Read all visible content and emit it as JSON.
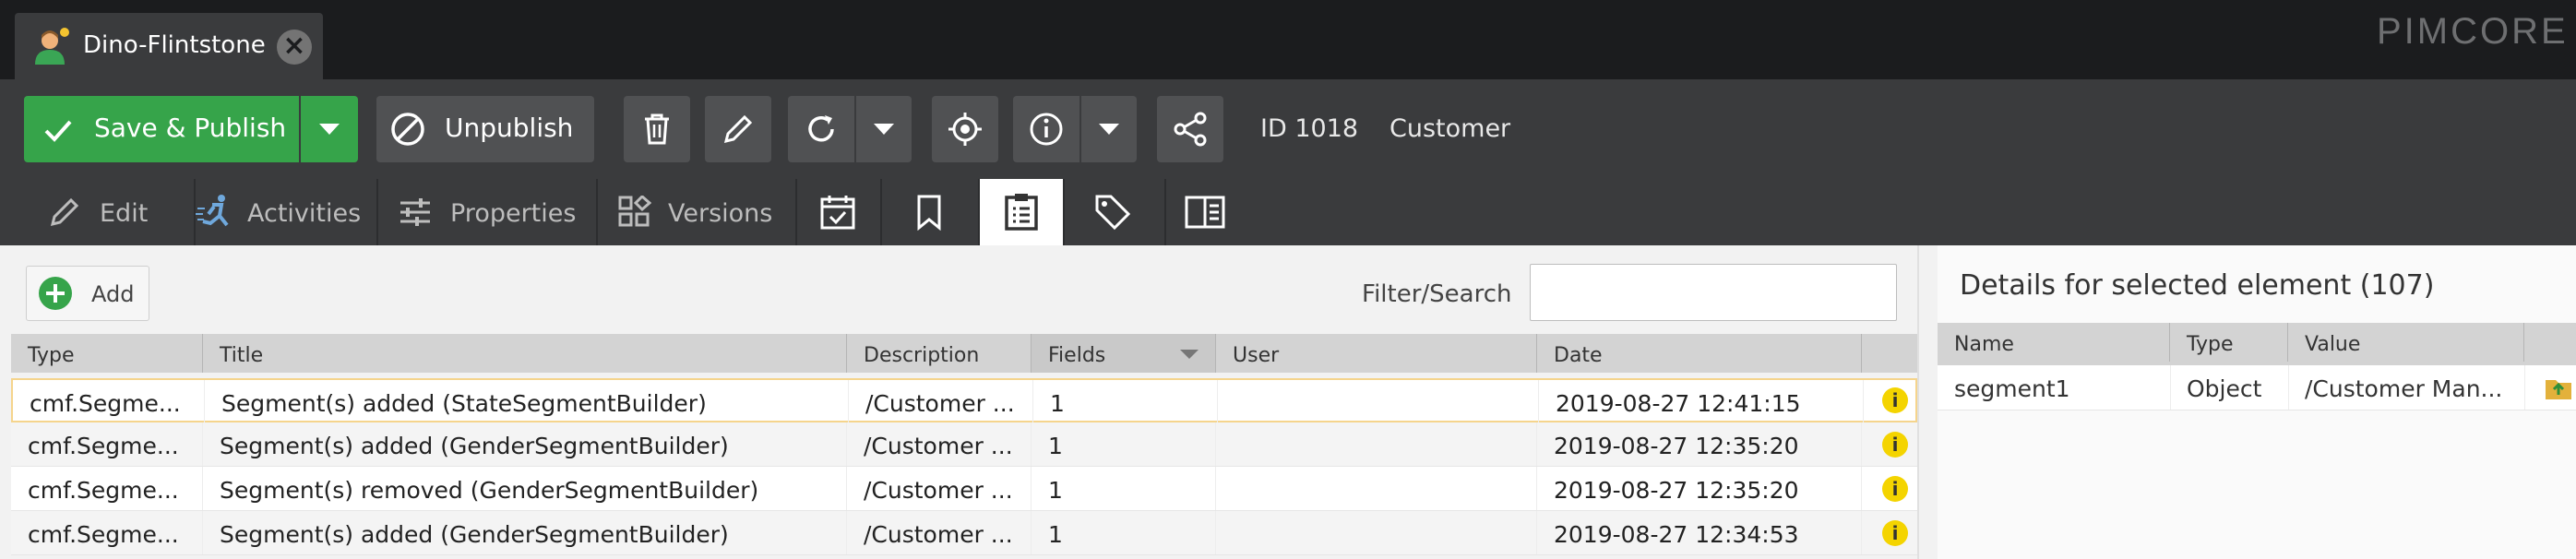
{
  "app": {
    "brand": "PIMCORE"
  },
  "document_tab": {
    "title": "Dino-Flintstone",
    "close_icon": "close-icon",
    "avatar_icon": "customer-avatar-icon"
  },
  "toolbar": {
    "save_publish": "Save & Publish",
    "unpublish": "Unpublish",
    "id_label": "ID 1018",
    "class_label": "Customer",
    "icons": [
      "trash-icon",
      "pencil-icon",
      "reload-icon",
      "chevron-down-icon",
      "locate-icon",
      "info-icon",
      "chevron-down-icon",
      "share-icon"
    ]
  },
  "edit_tabs": [
    {
      "label": "Edit",
      "icon": "pencil-icon"
    },
    {
      "label": "Activities",
      "icon": "running-person-icon"
    },
    {
      "label": "Properties",
      "icon": "sliders-icon"
    },
    {
      "label": "Versions",
      "icon": "versions-icon"
    },
    {
      "label": "",
      "icon": "calendar-check-icon"
    },
    {
      "label": "",
      "icon": "bookmark-icon"
    },
    {
      "label": "",
      "icon": "clipboard-icon"
    },
    {
      "label": "",
      "icon": "tag-icon"
    },
    {
      "label": "",
      "icon": "panel-icon"
    }
  ],
  "notes_panel": {
    "add_label": "Add",
    "filter_label": "Filter/Search",
    "filter_value": "",
    "columns": [
      "Type",
      "Title",
      "Description",
      "Fields",
      "User",
      "Date"
    ],
    "rows": [
      {
        "type": "cmf.Segme...",
        "title": "Segment(s) added (StateSegmentBuilder)",
        "description": "/Customer ...",
        "fields": "1",
        "user": "",
        "date": "2019-08-27 12:41:15"
      },
      {
        "type": "cmf.Segme...",
        "title": "Segment(s) added (GenderSegmentBuilder)",
        "description": "/Customer ...",
        "fields": "1",
        "user": "",
        "date": "2019-08-27 12:35:20"
      },
      {
        "type": "cmf.Segme...",
        "title": "Segment(s) removed (GenderSegmentBuilder)",
        "description": "/Customer ...",
        "fields": "1",
        "user": "",
        "date": "2019-08-27 12:35:20"
      },
      {
        "type": "cmf.Segme...",
        "title": "Segment(s) added (GenderSegmentBuilder)",
        "description": "/Customer ...",
        "fields": "1",
        "user": "",
        "date": "2019-08-27 12:34:53"
      }
    ]
  },
  "details_panel": {
    "title": "Details for selected element (107)",
    "columns": [
      "Name",
      "Type",
      "Value"
    ],
    "rows": [
      {
        "name": "segment1",
        "type": "Object",
        "value": "/Customer Man..."
      }
    ]
  },
  "colors": {
    "publish_green": "#36a44a",
    "topbar": "#1b1c1e",
    "toolbar": "#3a3b3d",
    "info_yellow": "#f4d400"
  }
}
